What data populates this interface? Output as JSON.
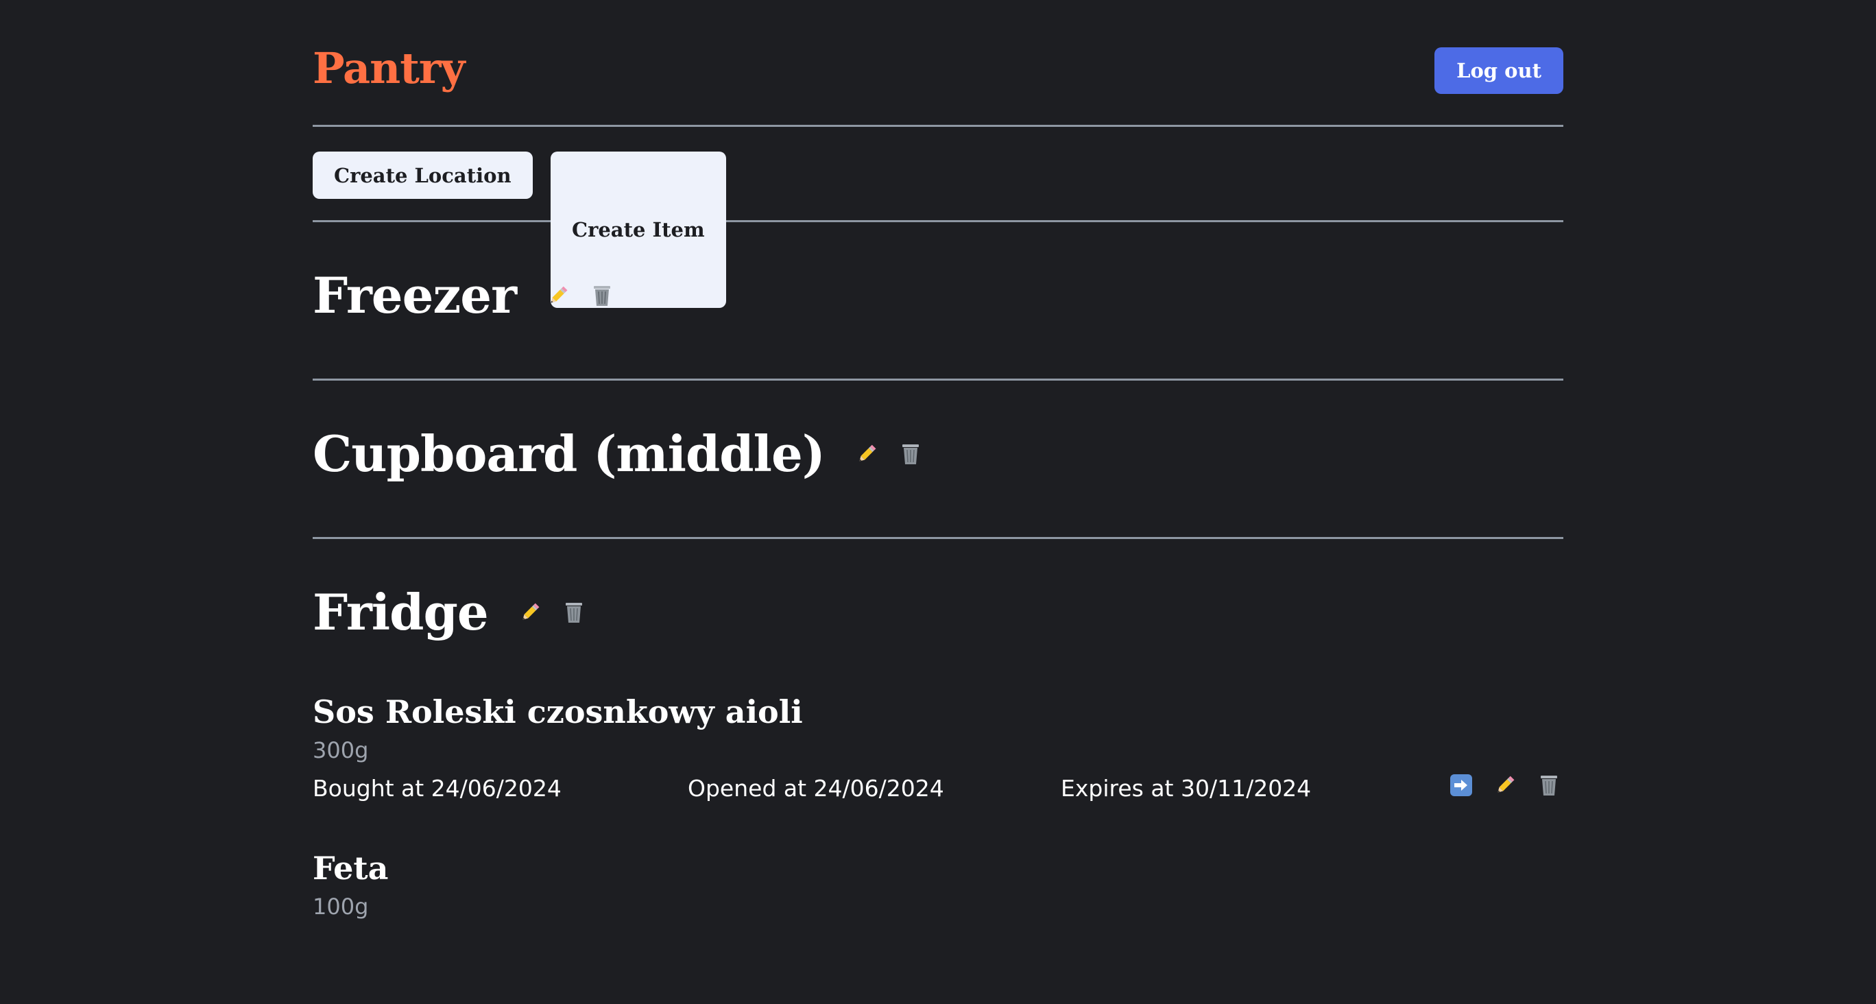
{
  "app": {
    "title": "Pantry",
    "logout_label": "Log out"
  },
  "toolbar": {
    "create_location_label": "Create Location",
    "create_item_label": "Create Item"
  },
  "locations": [
    {
      "name": "Freezer",
      "items": []
    },
    {
      "name": "Cupboard (middle)",
      "items": []
    },
    {
      "name": "Fridge",
      "items": [
        {
          "name": "Sos Roleski czosnkowy aioli",
          "quantity": "300g",
          "bought": "Bought at 24/06/2024",
          "opened": "Opened at 24/06/2024",
          "expires": "Expires at 30/11/2024"
        },
        {
          "name": "Feta",
          "quantity": "100g"
        }
      ]
    }
  ],
  "colors": {
    "background": "#1d1e22",
    "brand": "#ff7043",
    "primary_button": "#4d6be6",
    "secondary_button": "#eef2fb",
    "divider": "#8e97a3",
    "muted_text": "#9ea4ae"
  },
  "icons": [
    "pencil-icon",
    "trash-icon",
    "arrow-right-icon"
  ]
}
